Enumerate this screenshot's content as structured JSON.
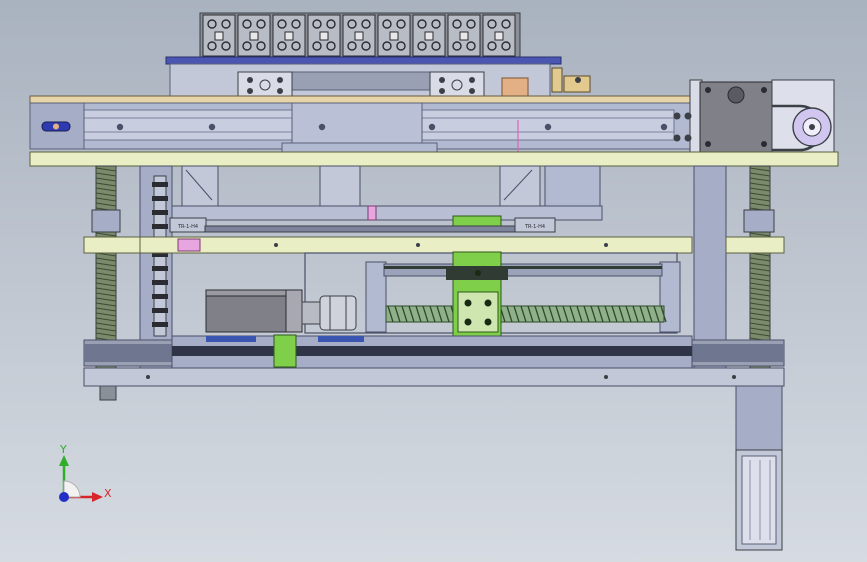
{
  "view": {
    "background_top": "#a9b2bf",
    "background_bottom": "#d6dbe2"
  },
  "palette": {
    "frame_blue": "#a6adc6",
    "frame_dark": "#6f7690",
    "rail_blue": "#b2bad2",
    "plate_yellow": "#e9eec4",
    "plate_wood": "#e6d5a8",
    "green": "#7fcf4a",
    "pink": "#e8a6e0",
    "motor_gray": "#7f8088",
    "blue_plate": "#4b56b2",
    "orange": "#e2b084"
  },
  "axes": {
    "x_label": "X",
    "y_label": "Y",
    "x_color": "#d6262c",
    "y_color": "#2fae2a",
    "z_color": "#2230c8"
  },
  "parts": {
    "gripper_count": 9,
    "screw_hint": "ball-screw"
  },
  "labels": {
    "left_block": "TR-1-H4",
    "right_block": "TR-1-H4"
  }
}
